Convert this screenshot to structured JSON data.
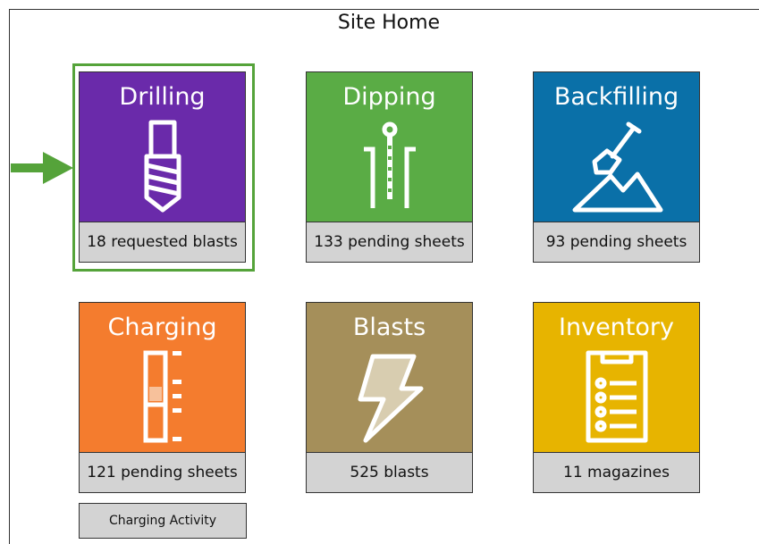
{
  "page": {
    "title": "Site Home"
  },
  "tiles": {
    "drilling": {
      "title": "Drilling",
      "status": "18 requested blasts",
      "icon": "drill-bit-icon",
      "color": "#6a2aaa"
    },
    "dipping": {
      "title": "Dipping",
      "status": "133 pending sheets",
      "icon": "dip-tape-icon",
      "color": "#5aac45"
    },
    "backfilling": {
      "title": "Backfilling",
      "status": "93 pending sheets",
      "icon": "shovel-icon",
      "color": "#0a70a8"
    },
    "charging": {
      "title": "Charging",
      "status": "121 pending sheets",
      "icon": "charge-column-icon",
      "color": "#f47c2e"
    },
    "blasts": {
      "title": "Blasts",
      "status": "525 blasts",
      "icon": "lightning-icon",
      "color": "#a58f5a"
    },
    "inventory": {
      "title": "Inventory",
      "status": "11 magazines",
      "icon": "clipboard-list-icon",
      "color": "#e7b400"
    }
  },
  "selection": {
    "selected_tile": "Drilling",
    "highlight_color": "#55a33a"
  },
  "buttons": {
    "charging_activity": "Charging Activity"
  }
}
